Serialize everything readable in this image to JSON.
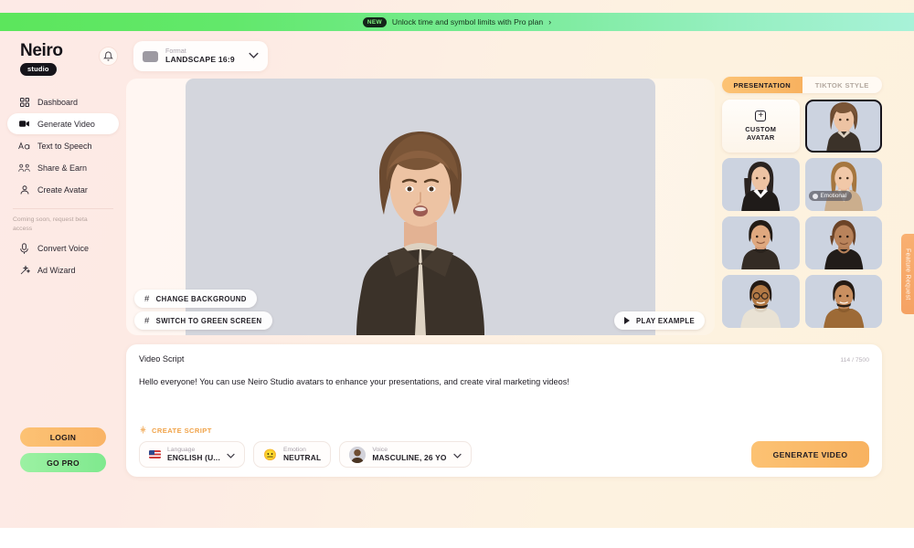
{
  "promo": {
    "badge": "NEW",
    "text": "Unlock time and symbol limits with Pro plan",
    "chevron": "›"
  },
  "brand": {
    "name": "Neiro",
    "tag": "studio"
  },
  "sidebar": {
    "bell_icon": "bell-icon",
    "items": [
      {
        "label": "Dashboard",
        "icon": "grid-icon",
        "active": false
      },
      {
        "label": "Generate Video",
        "icon": "video-camera-icon",
        "active": true
      },
      {
        "label": "Text to Speech",
        "icon": "text-aa-icon",
        "active": false
      },
      {
        "label": "Share & Earn",
        "icon": "people-icon",
        "active": false
      },
      {
        "label": "Create Avatar",
        "icon": "person-icon",
        "active": false
      }
    ],
    "coming_soon_note": "Coming soon, request beta access",
    "beta_items": [
      {
        "label": "Convert Voice",
        "icon": "microphone-icon"
      },
      {
        "label": "Ad Wizard",
        "icon": "magic-wand-icon"
      }
    ],
    "login_label": "LOGIN",
    "go_pro_label": "GO PRO"
  },
  "format": {
    "label": "Format",
    "value": "LANDSCAPE 16:9",
    "icon": "rectangle-icon",
    "chevron": "∨"
  },
  "stage": {
    "change_background_label": "CHANGE BACKGROUND",
    "green_screen_label": "SWITCH TO GREEN SCREEN",
    "play_example_label": "PLAY EXAMPLE",
    "hash_icon": "hash-icon",
    "play_icon": "play-icon"
  },
  "avatar_panel": {
    "tabs": [
      {
        "label": "PRESENTATION",
        "active": true
      },
      {
        "label": "TIKTOK STYLE",
        "active": false
      }
    ],
    "custom_avatar_label": "CUSTOM\nAVATAR",
    "custom_avatar_line1": "CUSTOM",
    "custom_avatar_line2": "AVATAR",
    "plus_icon": "plus-icon",
    "emotional_badge": "Emotional",
    "avatars": [
      {
        "name": "avatar-young-man-brown-jacket",
        "selected": true
      },
      {
        "name": "avatar-woman-black-suit",
        "selected": false
      },
      {
        "name": "avatar-woman-beige-coat",
        "selected": false,
        "badge": "Emotional"
      },
      {
        "name": "avatar-man-dark-sweater",
        "selected": false
      },
      {
        "name": "avatar-woman-black-top",
        "selected": false
      },
      {
        "name": "avatar-man-glasses-cream",
        "selected": false
      },
      {
        "name": "avatar-man-brown-sweater",
        "selected": false
      }
    ]
  },
  "script": {
    "title": "Video Script",
    "char_count": "114 / 7500",
    "body": "Hello everyone! You can use Neiro Studio avatars to enhance your presentations, and create viral marketing videos!",
    "create_script_label": "CREATE SCRIPT",
    "create_script_icon": "sparkle-icon"
  },
  "controls": {
    "language": {
      "label": "Language",
      "value": "ENGLISH (U...",
      "icon": "us-flag-icon"
    },
    "emotion": {
      "label": "Emotion",
      "value": "NEUTRAL",
      "icon": "neutral-face-emoji"
    },
    "voice": {
      "label": "Voice",
      "value": "MASCULINE, 26 YO",
      "icon": "voice-avatar-icon"
    },
    "generate_label": "GENERATE VIDEO"
  },
  "feature_request": {
    "label": "Feature Request"
  },
  "colors": {
    "accent_orange": "#f8b260",
    "accent_green": "#7fe98e",
    "banner_green": "#5ce65c",
    "background_pink": "#fdeae6",
    "video_gray": "#d4d6dd",
    "dark": "#16141a"
  }
}
